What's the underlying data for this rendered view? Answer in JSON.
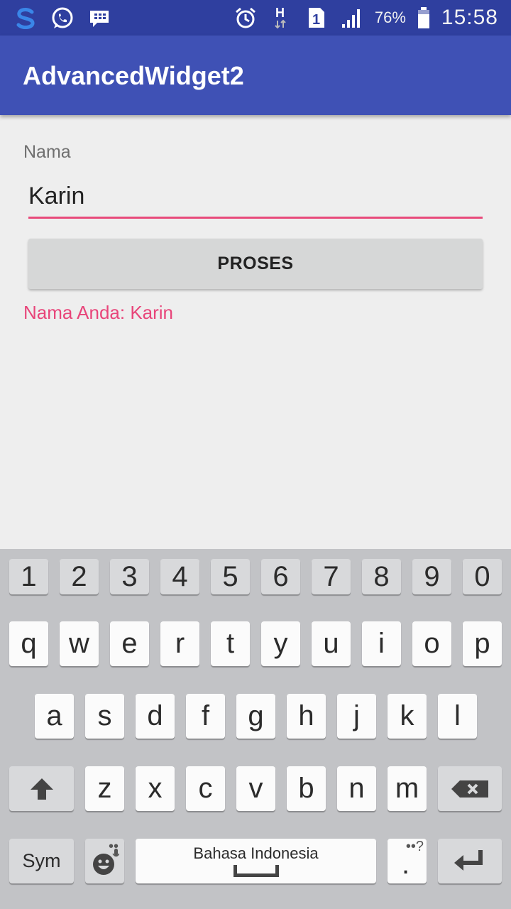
{
  "status_bar": {
    "icons_left": [
      "swype-icon",
      "whatsapp-icon",
      "bbm-icon"
    ],
    "icons_right": [
      "alarm-icon",
      "network-h-icon",
      "sim-1-icon",
      "signal-icon"
    ],
    "battery_percent": "76%",
    "time": "15:58"
  },
  "toolbar": {
    "title": "AdvancedWidget2"
  },
  "form": {
    "name_label": "Nama",
    "name_value": "Karin",
    "process_button": "PROSES",
    "result_text": "Nama Anda: Karin"
  },
  "keyboard": {
    "number_row": [
      "1",
      "2",
      "3",
      "4",
      "5",
      "6",
      "7",
      "8",
      "9",
      "0"
    ],
    "row1": [
      "q",
      "w",
      "e",
      "r",
      "t",
      "y",
      "u",
      "i",
      "o",
      "p"
    ],
    "row2": [
      "a",
      "s",
      "d",
      "f",
      "g",
      "h",
      "j",
      "k",
      "l"
    ],
    "row3": [
      "z",
      "x",
      "c",
      "v",
      "b",
      "n",
      "m"
    ],
    "sym_label": "Sym",
    "space_label": "Bahasa Indonesia",
    "emoji_hint": "••",
    "punct_hint": "••?",
    "period": "."
  },
  "colors": {
    "status_bar": "#2f3f9f",
    "toolbar": "#3f51b5",
    "accent": "#e84a7b",
    "background": "#eeeeee"
  }
}
